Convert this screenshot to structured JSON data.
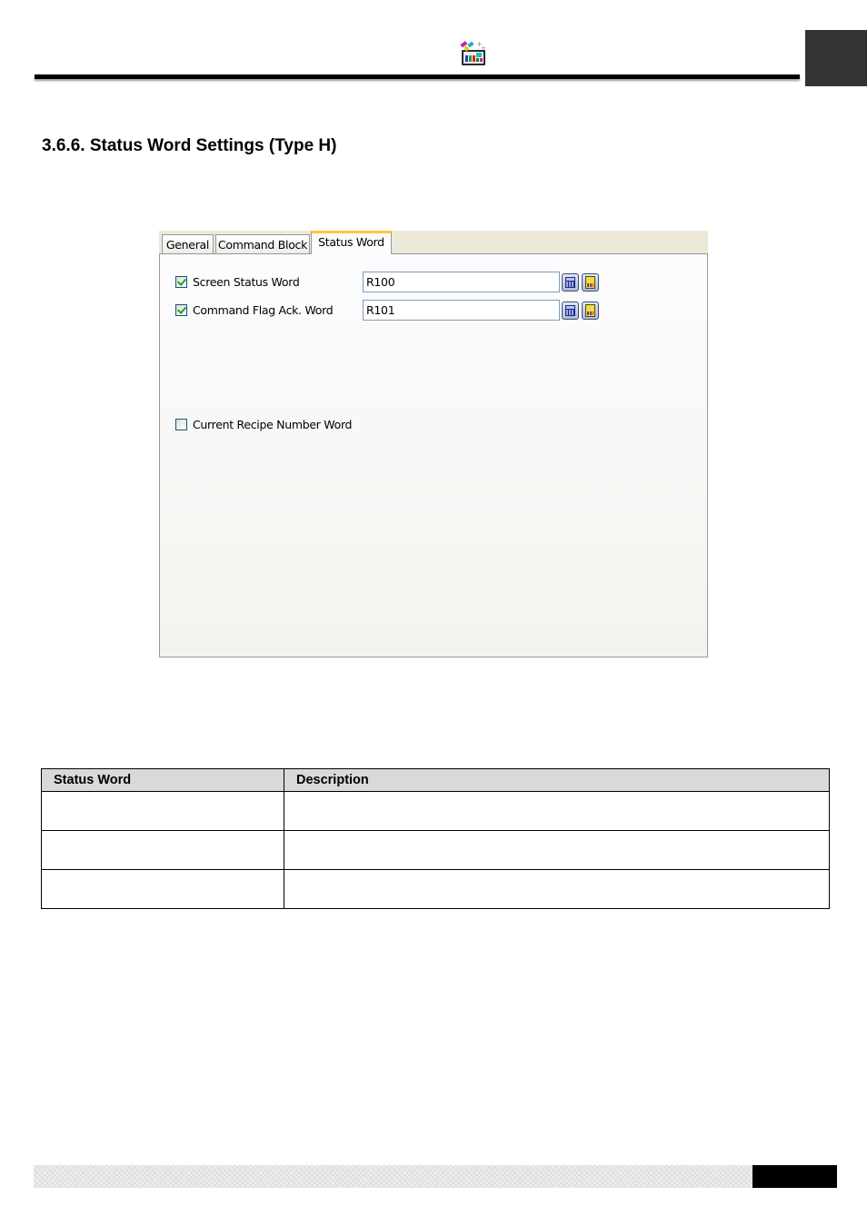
{
  "header": {
    "logo_icon": "software-logo-icon"
  },
  "section": {
    "title": "3.6.6. Status Word Settings (Type H)"
  },
  "dialog": {
    "tabs": [
      {
        "label": "General",
        "active": false
      },
      {
        "label": "Command Block",
        "active": false
      },
      {
        "label": "Status Word",
        "active": true
      }
    ],
    "options": [
      {
        "label": "Screen Status Word",
        "checked": true,
        "value": "R100",
        "icons": [
          "calculator-icon",
          "tag-icon"
        ]
      },
      {
        "label": "Command Flag Ack. Word",
        "checked": true,
        "value": "R101",
        "icons": [
          "calculator-icon",
          "tag-icon"
        ]
      },
      {
        "label": "Current Recipe Number Word",
        "checked": false
      }
    ]
  },
  "table": {
    "headers": [
      "Status Word",
      "Description"
    ],
    "rows": [
      [
        "",
        ""
      ],
      [
        "",
        ""
      ],
      [
        "",
        ""
      ]
    ]
  }
}
